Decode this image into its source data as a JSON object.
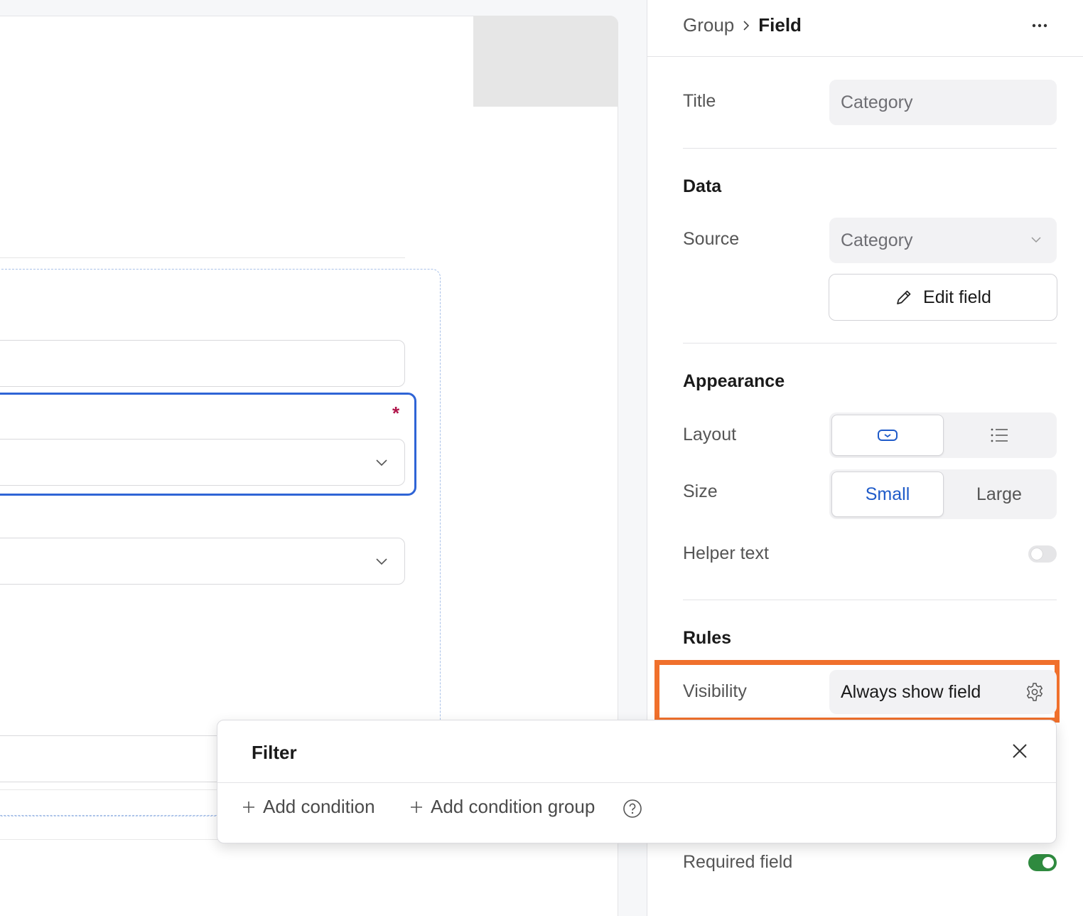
{
  "panel": {
    "breadcrumb": {
      "parent": "Group",
      "current": "Field"
    },
    "title": {
      "label": "Title",
      "value": "Category"
    },
    "data_section": {
      "heading": "Data",
      "source_label": "Source",
      "source_value": "Category",
      "edit_button": "Edit field"
    },
    "appearance": {
      "heading": "Appearance",
      "layout_label": "Layout",
      "layout_options": [
        "dropdown-icon",
        "list-icon"
      ],
      "layout_selected": "dropdown-icon",
      "size_label": "Size",
      "size_options": [
        "Small",
        "Large"
      ],
      "size_selected": "Small",
      "helper_text_label": "Helper text",
      "helper_text_enabled": false
    },
    "rules": {
      "heading": "Rules",
      "visibility_label": "Visibility",
      "visibility_value": "Always show field",
      "required_label": "Required field",
      "required_enabled": true
    }
  },
  "filter_popover": {
    "title": "Filter",
    "add_condition": "Add condition",
    "add_condition_group": "Add condition group"
  },
  "canvas": {
    "required_marker": "*"
  },
  "colors": {
    "accent_blue": "#2f64d6",
    "highlight_orange": "#f0702c",
    "toggle_on_green": "#2f8a3f",
    "required_red": "#b0154a"
  }
}
